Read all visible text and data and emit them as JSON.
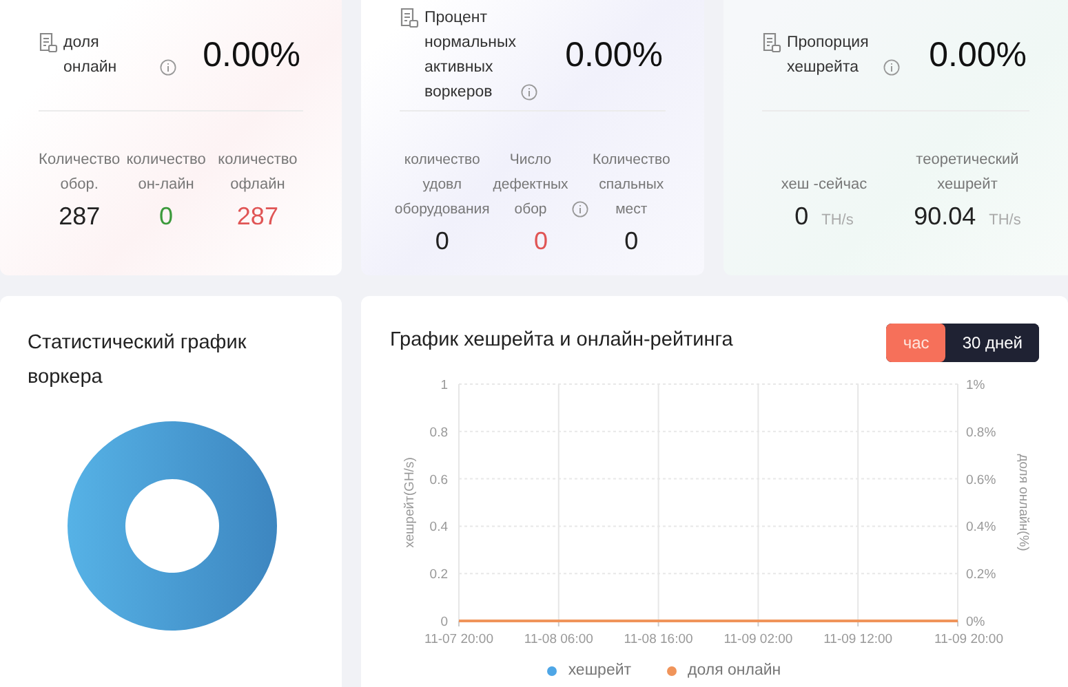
{
  "cards": [
    {
      "title": "доля онлайн",
      "value": "0.00%",
      "stats": [
        {
          "label": "Количество обор.",
          "value": "287",
          "color": "#222222",
          "info_icon": false
        },
        {
          "label": "количество он-лайн",
          "value": "0",
          "color": "#3c9a3c",
          "info_icon": false
        },
        {
          "label": "количество офлайн",
          "value": "287",
          "color": "#e05555",
          "info_icon": false
        }
      ]
    },
    {
      "title": "Процент нормальных активных воркеров",
      "value": "0.00%",
      "stats": [
        {
          "label": "количество удовл оборудования",
          "value": "0",
          "color": "#222222",
          "info_icon": false
        },
        {
          "label": "Число дефектных обор",
          "value": "0",
          "color": "#e05555",
          "info_icon": true
        },
        {
          "label": "Количество спальных мест",
          "value": "0",
          "color": "#222222",
          "info_icon": false
        }
      ]
    },
    {
      "title": "Пропорция хешрейта",
      "value": "0.00%",
      "stats": [
        {
          "label": "хеш -сейчас",
          "value": "0",
          "unit": "TH/s",
          "color": "#222222",
          "info_icon": false
        },
        {
          "label": "теоретический хешрейт",
          "value": "90.04",
          "unit": "TH/s",
          "color": "#222222",
          "info_icon": false
        }
      ]
    }
  ],
  "worker_chart": {
    "title": "Статистический график воркера"
  },
  "hashrate_chart": {
    "title": "График хешрейта и онлайн-рейтинга",
    "tabs": [
      {
        "label": "час",
        "selected": true
      },
      {
        "label": "30 дней",
        "selected": false
      }
    ],
    "chart_data": {
      "type": "line",
      "ylabel": "хешрейт(GH/s)",
      "x": [
        "11-07 20:00",
        "11-08 06:00",
        "11-08 16:00",
        "11-09 02:00",
        "11-09 12:00",
        "11-09 20:00"
      ],
      "ylim": [
        0,
        1
      ],
      "grid": true,
      "legend": "bottom",
      "yticks": [
        0,
        0.2,
        0.4,
        0.6,
        0.8,
        1
      ],
      "series": [
        {
          "name": "хешрейт",
          "color": "#4ea6e6",
          "values": [
            null,
            null,
            null,
            null,
            null,
            null
          ]
        },
        {
          "name": "доля онлайн",
          "color": "#f0945a",
          "values": [
            0,
            0,
            0,
            0,
            0,
            0
          ]
        }
      ]
    },
    "right_axis": {
      "label": "доля онлайн(%)",
      "ticks": [
        "1%",
        "0.8%",
        "0.6%",
        "0.4%",
        "0.2%",
        "0%"
      ]
    }
  }
}
